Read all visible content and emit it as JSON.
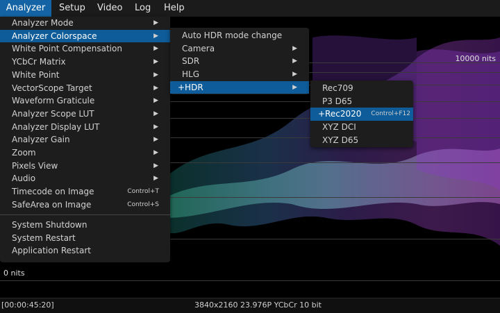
{
  "menubar": [
    "Analyzer",
    "Setup",
    "Video",
    "Log",
    "Help"
  ],
  "scope": {
    "top_label": "10000 nits",
    "bottom_label": "0 nits"
  },
  "analyzer_menu": {
    "items": [
      "Analyzer Mode",
      "Analyzer Colorspace",
      "White Point Compensation",
      "YCbCr Matrix",
      "White Point",
      "VectorScope Target",
      "Waveform Graticule",
      "Analyzer Scope LUT",
      "Analyzer Display LUT",
      "Analyzer Gain",
      "Zoom",
      "Pixels View",
      "Audio",
      "Timecode on Image",
      "SafeArea on Image"
    ],
    "shortcuts": {
      "timecode": "Control+T",
      "safearea": "Control+S"
    },
    "system_items": [
      "System Shutdown",
      "System Restart",
      "Application Restart"
    ]
  },
  "colorspace_menu": {
    "items": [
      "Auto HDR mode change",
      "Camera",
      "SDR",
      "HLG",
      "+HDR"
    ]
  },
  "hdr_menu": {
    "items": [
      "Rec709",
      "P3 D65",
      "+Rec2020",
      "XYZ DCI",
      "XYZ D65"
    ],
    "selected_shortcut": "Control+F12"
  },
  "status": {
    "timecode": "[00:00:45:20]",
    "format": "3840x2160 23.976P YCbCr 10 bit"
  },
  "colors": {
    "accent": "#0e5c99",
    "menu_bg": "#1d1d1d"
  }
}
